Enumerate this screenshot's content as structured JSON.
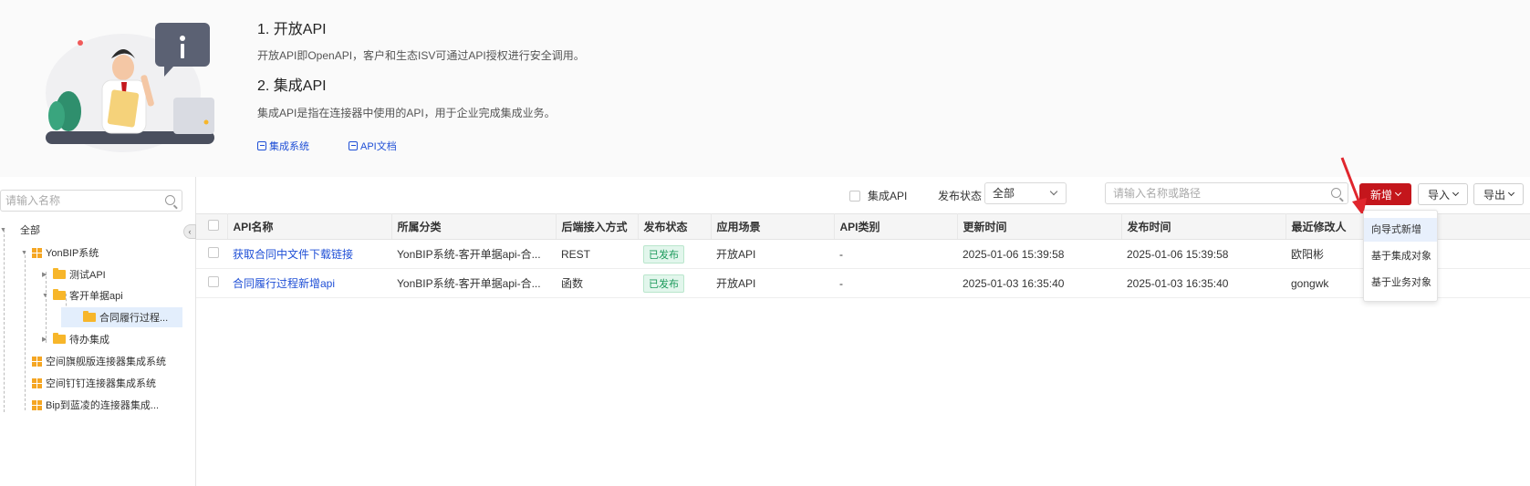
{
  "intro": {
    "title1": "1. 开放API",
    "desc1": "开放API即OpenAPI，客户和生态ISV可通过API授权进行安全调用。",
    "title2": "2. 集成API",
    "desc2": "集成API是指在连接器中使用的API，用于企业完成集成业务。",
    "link1": "集成系统",
    "link2": "API文档"
  },
  "tree": {
    "search_placeholder": "请输入名称",
    "nodes": [
      {
        "label": "全部"
      },
      {
        "label": "YonBIP系统"
      },
      {
        "label": "测试API"
      },
      {
        "label": "客开单据api"
      },
      {
        "label": "合同履行过程..."
      },
      {
        "label": "待办集成"
      },
      {
        "label": "空间旗舰版连接器集成系统"
      },
      {
        "label": "空间钉钉连接器集成系统"
      },
      {
        "label": "Bip到蓝凌的连接器集成..."
      }
    ]
  },
  "toolbar": {
    "integration_api_label": "集成API",
    "status_label": "发布状态",
    "status_value": "全部",
    "search_placeholder": "请输入名称或路径",
    "new_label": "新增",
    "import_label": "导入",
    "export_label": "导出"
  },
  "table": {
    "columns": [
      "API名称",
      "所属分类",
      "后端接入方式",
      "发布状态",
      "应用场景",
      "API类别",
      "更新时间",
      "发布时间",
      "最近修改人"
    ],
    "rows": [
      {
        "name": "获取合同中文件下载链接",
        "category": "YonBIP系统-客开单据api-合...",
        "backend": "REST",
        "status": "已发布",
        "scene": "开放API",
        "type": "-",
        "updated": "2025-01-06 15:39:58",
        "published": "2025-01-06 15:39:58",
        "modifier": "欧阳彬"
      },
      {
        "name": "合同履行过程新增api",
        "category": "YonBIP系统-客开单据api-合...",
        "backend": "函数",
        "status": "已发布",
        "scene": "开放API",
        "type": "-",
        "updated": "2025-01-03 16:35:40",
        "published": "2025-01-03 16:35:40",
        "modifier": "gongwk"
      }
    ]
  },
  "dropdown": {
    "items": [
      {
        "label": "向导式新增"
      },
      {
        "label": "基于集成对象"
      },
      {
        "label": "基于业务对象"
      }
    ]
  },
  "colors": {
    "accent_red": "#c4161c",
    "link_blue": "#1f4fd6",
    "tag_green": "#1c9a5b",
    "folder_orange": "#f7b62a"
  }
}
